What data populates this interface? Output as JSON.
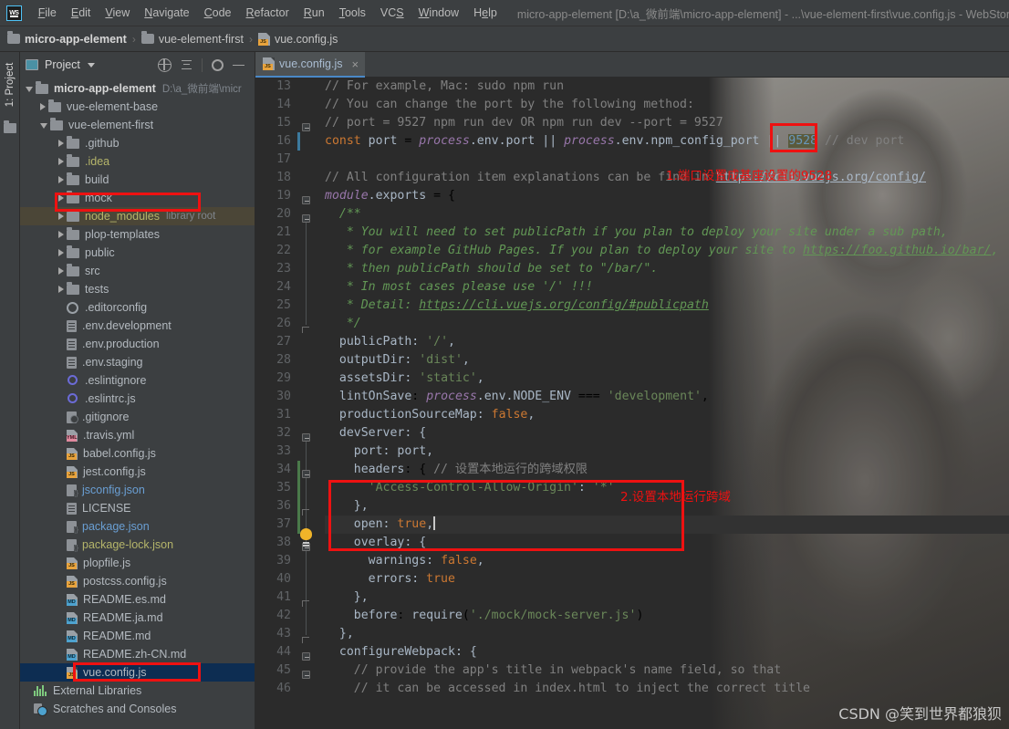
{
  "window": {
    "title": "micro-app-element [D:\\a_微前端\\micro-app-element] - ...\\vue-element-first\\vue.config.js - WebStorm",
    "logo": "webstorm-logo"
  },
  "menubar": {
    "items": [
      "File",
      "Edit",
      "View",
      "Navigate",
      "Code",
      "Refactor",
      "Run",
      "Tools",
      "VCS",
      "Window",
      "Help"
    ]
  },
  "breadcrumb": {
    "items": [
      {
        "label": "micro-app-element",
        "icon": "folder-icon",
        "bold": true
      },
      {
        "label": "vue-element-first",
        "icon": "folder-icon",
        "bold": false
      },
      {
        "label": "vue.config.js",
        "icon": "js-file-icon",
        "bold": false
      }
    ],
    "separator": "›"
  },
  "toolstrip": {
    "project_tab": "1: Project"
  },
  "project_panel": {
    "title": "Project",
    "actions": [
      "locate-icon",
      "collapse-all-icon",
      "settings-gear-icon",
      "hide-icon"
    ],
    "tree": [
      {
        "label": "micro-app-element",
        "note": "D:\\a_微前端\\micr",
        "icon": "folder-icon",
        "arrow": "open",
        "indent": 0,
        "bold": true,
        "color": "#d6d6d6"
      },
      {
        "label": "vue-element-base",
        "icon": "folder-icon",
        "arrow": "closed",
        "indent": 1
      },
      {
        "label": "vue-element-first",
        "icon": "folder-icon",
        "arrow": "open",
        "indent": 1,
        "boxed": true
      },
      {
        "label": ".github",
        "icon": "folder-icon",
        "arrow": "closed",
        "indent": 2
      },
      {
        "label": ".idea",
        "icon": "folder-icon",
        "arrow": "closed",
        "indent": 2,
        "color": "#b5b56a"
      },
      {
        "label": "build",
        "icon": "folder-icon",
        "arrow": "closed",
        "indent": 2
      },
      {
        "label": "mock",
        "icon": "folder-icon",
        "arrow": "closed",
        "indent": 2
      },
      {
        "label": "node_modules",
        "note": "library root",
        "icon": "folder-icon",
        "arrow": "closed",
        "indent": 2,
        "color": "#b5b56a",
        "highlight": true
      },
      {
        "label": "plop-templates",
        "icon": "folder-icon",
        "arrow": "closed",
        "indent": 2
      },
      {
        "label": "public",
        "icon": "folder-icon",
        "arrow": "closed",
        "indent": 2
      },
      {
        "label": "src",
        "icon": "folder-icon",
        "arrow": "closed",
        "indent": 2
      },
      {
        "label": "tests",
        "icon": "folder-icon",
        "arrow": "closed",
        "indent": 2
      },
      {
        "label": ".editorconfig",
        "icon": "gear-file-icon",
        "arrow": "none",
        "indent": 2
      },
      {
        "label": ".env.development",
        "icon": "text-file-icon",
        "arrow": "none",
        "indent": 2
      },
      {
        "label": ".env.production",
        "icon": "text-file-icon",
        "arrow": "none",
        "indent": 2
      },
      {
        "label": ".env.staging",
        "icon": "text-file-icon",
        "arrow": "none",
        "indent": 2
      },
      {
        "label": ".eslintignore",
        "icon": "eslint-icon",
        "arrow": "none",
        "indent": 2
      },
      {
        "label": ".eslintrc.js",
        "icon": "eslint-icon",
        "arrow": "none",
        "indent": 2
      },
      {
        "label": ".gitignore",
        "icon": "gitignore-icon",
        "arrow": "none",
        "indent": 2
      },
      {
        "label": ".travis.yml",
        "icon": "yml-file-icon",
        "arrow": "none",
        "indent": 2
      },
      {
        "label": "babel.config.js",
        "icon": "js-file-icon",
        "arrow": "none",
        "indent": 2
      },
      {
        "label": "jest.config.js",
        "icon": "js-file-icon",
        "arrow": "none",
        "indent": 2
      },
      {
        "label": "jsconfig.json",
        "icon": "json-file-icon",
        "arrow": "none",
        "indent": 2,
        "color": "#6a9fd4"
      },
      {
        "label": "LICENSE",
        "icon": "text-file-icon",
        "arrow": "none",
        "indent": 2
      },
      {
        "label": "package.json",
        "icon": "json-file-icon",
        "arrow": "none",
        "indent": 2,
        "color": "#6a9fd4"
      },
      {
        "label": "package-lock.json",
        "icon": "json-file-icon",
        "arrow": "none",
        "indent": 2,
        "color": "#b5b56a"
      },
      {
        "label": "plopfile.js",
        "icon": "js-file-icon",
        "arrow": "none",
        "indent": 2
      },
      {
        "label": "postcss.config.js",
        "icon": "js-file-icon",
        "arrow": "none",
        "indent": 2
      },
      {
        "label": "README.es.md",
        "icon": "md-file-icon",
        "arrow": "none",
        "indent": 2
      },
      {
        "label": "README.ja.md",
        "icon": "md-file-icon",
        "arrow": "none",
        "indent": 2
      },
      {
        "label": "README.md",
        "icon": "md-file-icon",
        "arrow": "none",
        "indent": 2
      },
      {
        "label": "README.zh-CN.md",
        "icon": "md-file-icon",
        "arrow": "none",
        "indent": 2
      },
      {
        "label": "vue.config.js",
        "icon": "js-file-icon",
        "arrow": "none",
        "indent": 2,
        "selected": true,
        "boxed": true
      },
      {
        "label": "External Libraries",
        "icon": "libraries-icon",
        "arrow": "none",
        "indent": 0
      },
      {
        "label": "Scratches and Consoles",
        "icon": "scratches-icon",
        "arrow": "none",
        "indent": 0
      }
    ]
  },
  "editor": {
    "tab": {
      "label": "vue.config.js",
      "icon": "js-file-icon",
      "close": "×"
    },
    "first_line_number": 13,
    "current_line": 37,
    "lines": [
      {
        "n": 13,
        "text": "  // For example, Mac: sudo npm run"
      },
      {
        "n": 14,
        "text": "  // You can change the port by the following method:"
      },
      {
        "n": 15,
        "text": "  // port = 9527 npm run dev OR npm run dev --port = 9527"
      },
      {
        "n": 16,
        "text": "  const port = process.env.port || process.env.npm_config_port || 9528 // dev port"
      },
      {
        "n": 17,
        "text": ""
      },
      {
        "n": 18,
        "text": "  // All configuration item explanations can be find in https://cli.vuejs.org/config/"
      },
      {
        "n": 19,
        "text": "  module.exports = {"
      },
      {
        "n": 20,
        "text": "    /**"
      },
      {
        "n": 21,
        "text": "     * You will need to set publicPath if you plan to deploy your site under a sub path,"
      },
      {
        "n": 22,
        "text": "     * for example GitHub Pages. If you plan to deploy your site to https://foo.github.io/bar/,"
      },
      {
        "n": 23,
        "text": "     * then publicPath should be set to \"/bar/\"."
      },
      {
        "n": 24,
        "text": "     * In most cases please use '/' !!!"
      },
      {
        "n": 25,
        "text": "     * Detail: https://cli.vuejs.org/config/#publicpath"
      },
      {
        "n": 26,
        "text": "     */"
      },
      {
        "n": 27,
        "text": "    publicPath: '/',"
      },
      {
        "n": 28,
        "text": "    outputDir: 'dist',"
      },
      {
        "n": 29,
        "text": "    assetsDir: 'static',"
      },
      {
        "n": 30,
        "text": "    lintOnSave: process.env.NODE_ENV === 'development',"
      },
      {
        "n": 31,
        "text": "    productionSourceMap: false,"
      },
      {
        "n": 32,
        "text": "    devServer: {"
      },
      {
        "n": 33,
        "text": "      port: port,"
      },
      {
        "n": 34,
        "text": "      headers: { // 设置本地运行的跨域权限"
      },
      {
        "n": 35,
        "text": "        'Access-Control-Allow-Origin': '*'"
      },
      {
        "n": 36,
        "text": "      },"
      },
      {
        "n": 37,
        "text": "      open: true,"
      },
      {
        "n": 38,
        "text": "      overlay: {"
      },
      {
        "n": 39,
        "text": "        warnings: false,"
      },
      {
        "n": 40,
        "text": "        errors: true"
      },
      {
        "n": 41,
        "text": "      },"
      },
      {
        "n": 42,
        "text": "      before: require('./mock/mock-server.js')"
      },
      {
        "n": 43,
        "text": "    },"
      },
      {
        "n": 44,
        "text": "    configureWebpack: {"
      },
      {
        "n": 45,
        "text": "      // provide the app's title in webpack's name field, so that"
      },
      {
        "n": 46,
        "text": "      // it can be accessed in index.html to inject the correct title"
      }
    ]
  },
  "annotations": {
    "color": "#f01010",
    "items": [
      {
        "id": "port-note",
        "text": "1.端口设置成基座设置的9528"
      },
      {
        "id": "cors-note",
        "text": "2.设置本地运行跨域"
      }
    ]
  },
  "watermark": {
    "text": "CSDN @笑到世界都狼狈"
  },
  "colors": {
    "accent_tab": "#4a88c7",
    "selection": "#0d2d52",
    "annotation_red": "#f01010",
    "editor_bg": "#2b2b2b",
    "panel_bg": "#3c3f41"
  }
}
